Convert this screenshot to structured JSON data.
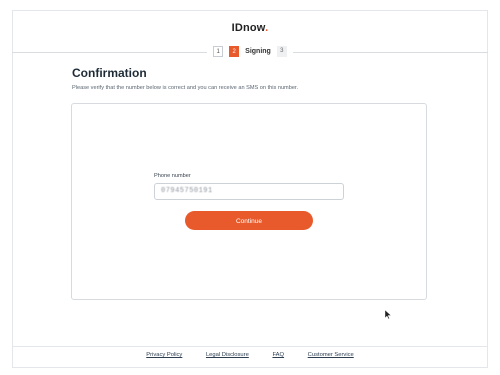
{
  "header": {
    "logo_text": "IDnow",
    "logo_dot": "."
  },
  "stepper": {
    "steps": [
      {
        "number": "1",
        "state": "done"
      },
      {
        "number": "2",
        "state": "active",
        "label": "Signing"
      },
      {
        "number": "3",
        "state": "future"
      }
    ]
  },
  "main": {
    "title": "Confirmation",
    "subtitle": "Please verify that the number below is correct and you can receive an SMS on this number.",
    "phone_label": "Phone number",
    "phone_value": "07945750191",
    "continue_label": "Continue"
  },
  "footer": {
    "links": [
      "Privacy Policy",
      "Legal Disclosure",
      "FAQ",
      "Customer Service"
    ]
  },
  "colors": {
    "accent": "#e85a2b"
  }
}
